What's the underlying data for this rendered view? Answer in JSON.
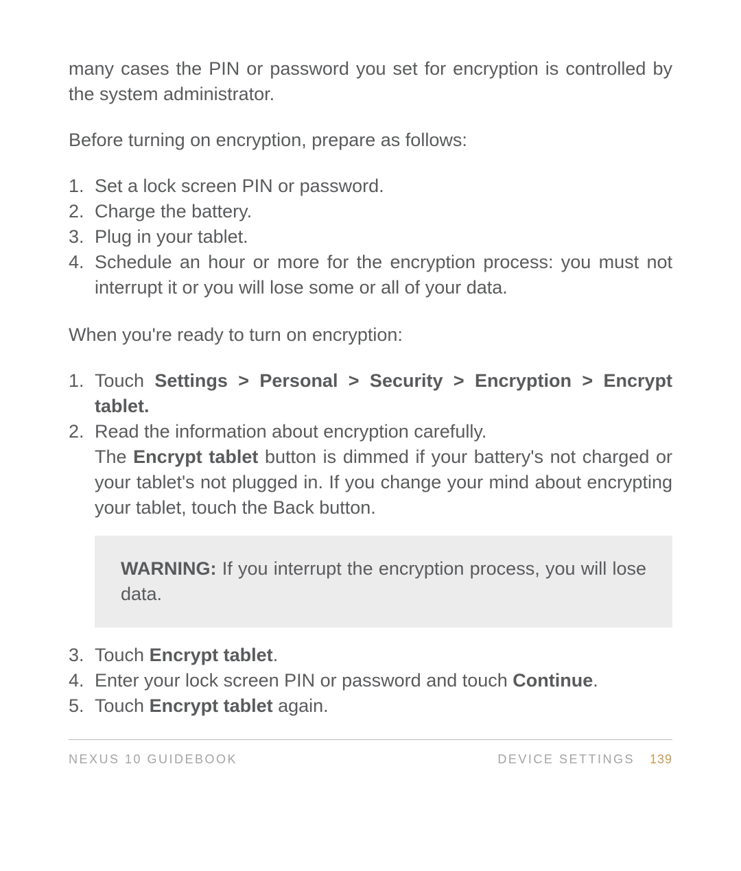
{
  "intro_para": "many cases the PIN or password you set for encryption is controlled by the system administrator.",
  "prep_heading": "Before turning on encryption, prepare as follows:",
  "prep_list": [
    "Set a lock screen PIN or password.",
    "Charge the battery.",
    "Plug in your tablet.",
    "Schedule an hour or more for the encryption process: you must not interrupt it or you will lose some or all of your data."
  ],
  "ready_heading": "When you're ready to turn on encryption:",
  "step1_prefix": "Touch ",
  "step1_bold": "Settings > Personal > Security > Encryption > Encrypt tablet.",
  "step2_line1": "Read the information about encryption carefully.",
  "step2_line2_a": "The ",
  "step2_line2_bold": "Encrypt tablet",
  "step2_line2_b": " button is dimmed if your battery's not charged or your tablet's not plugged in. If you change your mind about encrypting your tablet, touch the Back button.",
  "warning_label": "WARNING:",
  "warning_text": " If you interrupt the encryption process, you will lose data.",
  "step3_prefix": "Touch ",
  "step3_bold": "Encrypt tablet",
  "step3_suffix": ".",
  "step4_prefix": "Enter your lock screen PIN or password and touch ",
  "step4_bold": "Continue",
  "step4_suffix": ".",
  "step5_prefix": "Touch ",
  "step5_bold": "Encrypt tablet",
  "step5_suffix": " again.",
  "footer": {
    "left": "Nexus 10 Guidebook",
    "right_label": "Device Settings",
    "page": "139"
  }
}
